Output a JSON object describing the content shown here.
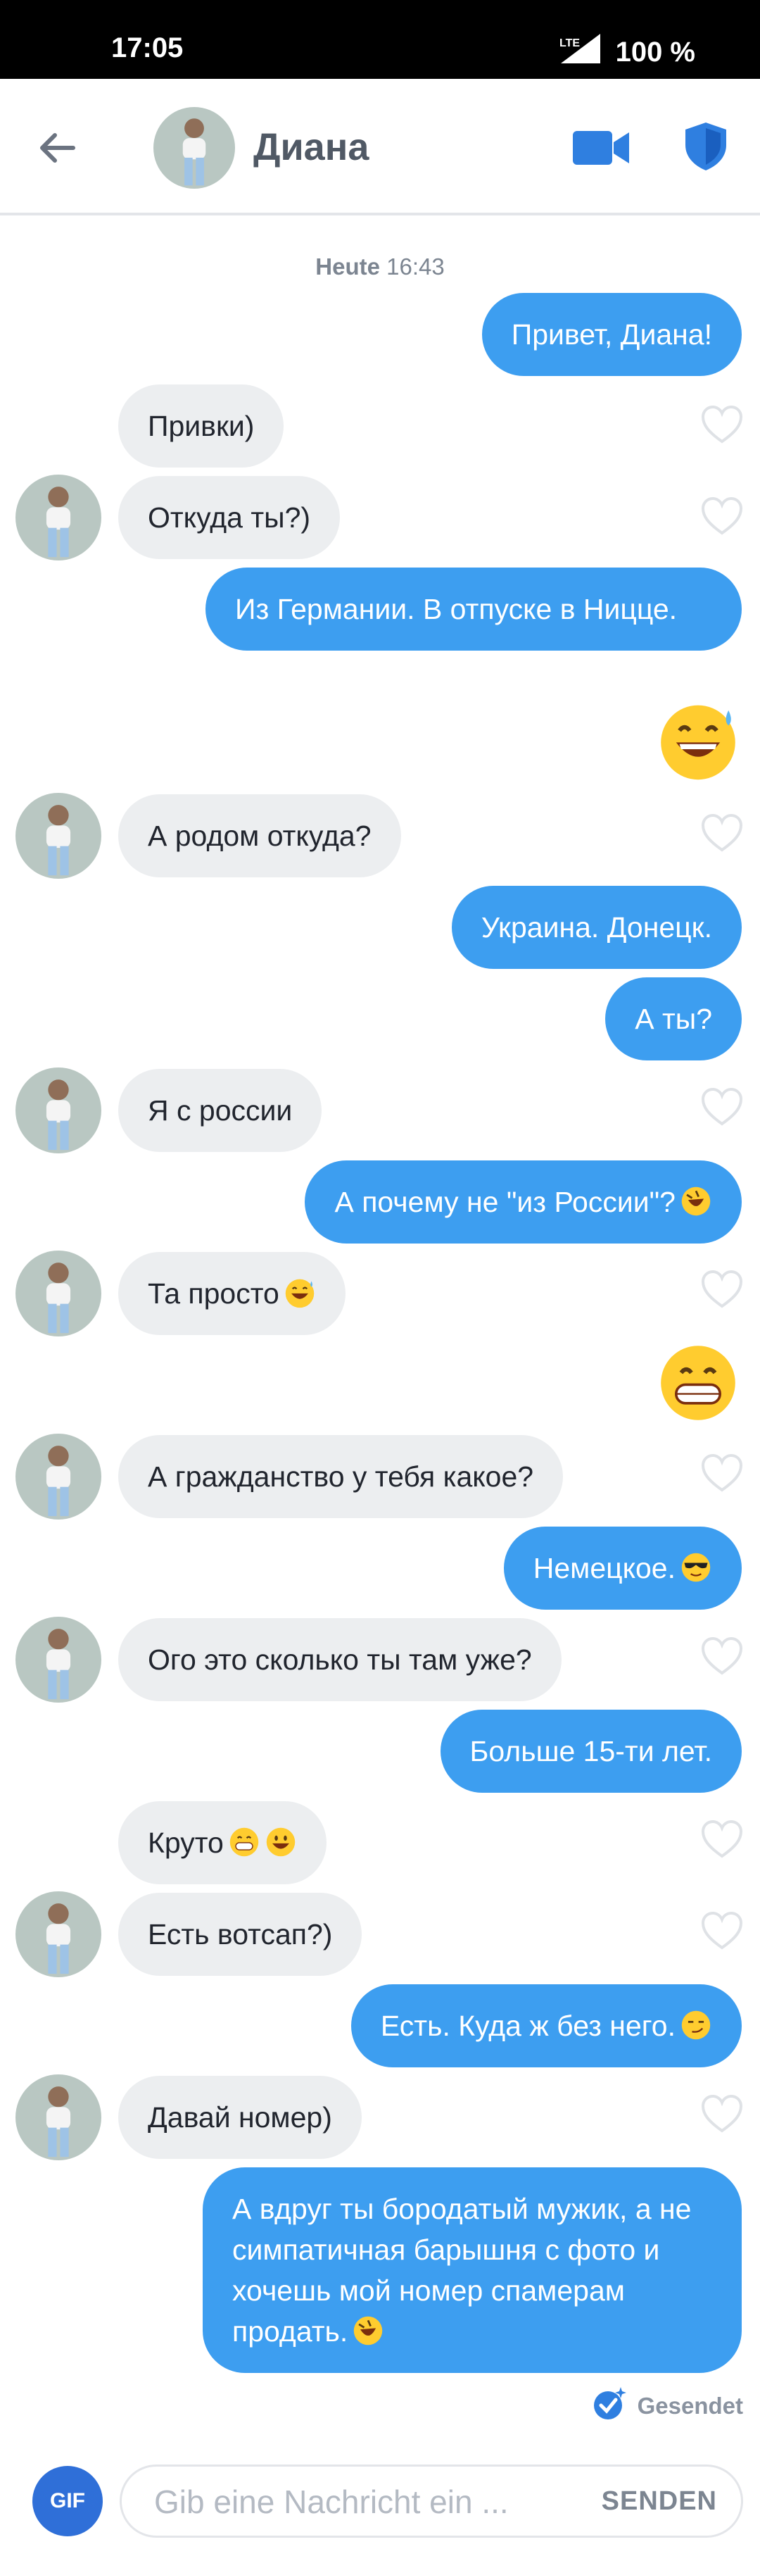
{
  "status_bar": {
    "time": "17:05",
    "network": "LTE",
    "battery": "100 %"
  },
  "header": {
    "contact_name": "Диана"
  },
  "timestamp": {
    "day": "Heute",
    "time": "16:43"
  },
  "messages": {
    "m1": "Привет, Диана!",
    "m2": "Привки)",
    "m3": "Откуда ты?)",
    "m4": "Из Германии. В отпуске в Ницце.",
    "m6": "А родом откуда?",
    "m7": "Украина. Донецк.",
    "m8": "А ты?",
    "m9": "Я с россии",
    "m10": "А почему не \"из России\"?",
    "m11": "Та просто",
    "m13": "А гражданство у тебя какое?",
    "m14": "Немецкое.",
    "m15": "Ого это сколько ты там уже?",
    "m16": "Больше 15-ти лет.",
    "m17": "Круто",
    "m18": "Есть вотсап?)",
    "m19": "Есть. Куда ж без него.",
    "m20": "Давай номер)",
    "m21": "А вдруг ты бородатый мужик, а не симпатичная барышня с фото и хочешь мой номер спамерам продать."
  },
  "emoji_icons": [
    "grinning-sweat-emoji",
    "rofl-emoji",
    "grin-emoji",
    "sunglasses-emoji",
    "smirk-emoji"
  ],
  "sent_status": "Gesendet",
  "composer": {
    "gif_label": "GIF",
    "placeholder": "Gib eine Nachricht ein ...",
    "send_label": "SENDEN"
  },
  "colors": {
    "outgoing": "#3d9ef0",
    "incoming": "#eceef0",
    "accent": "#2f6fd8"
  }
}
